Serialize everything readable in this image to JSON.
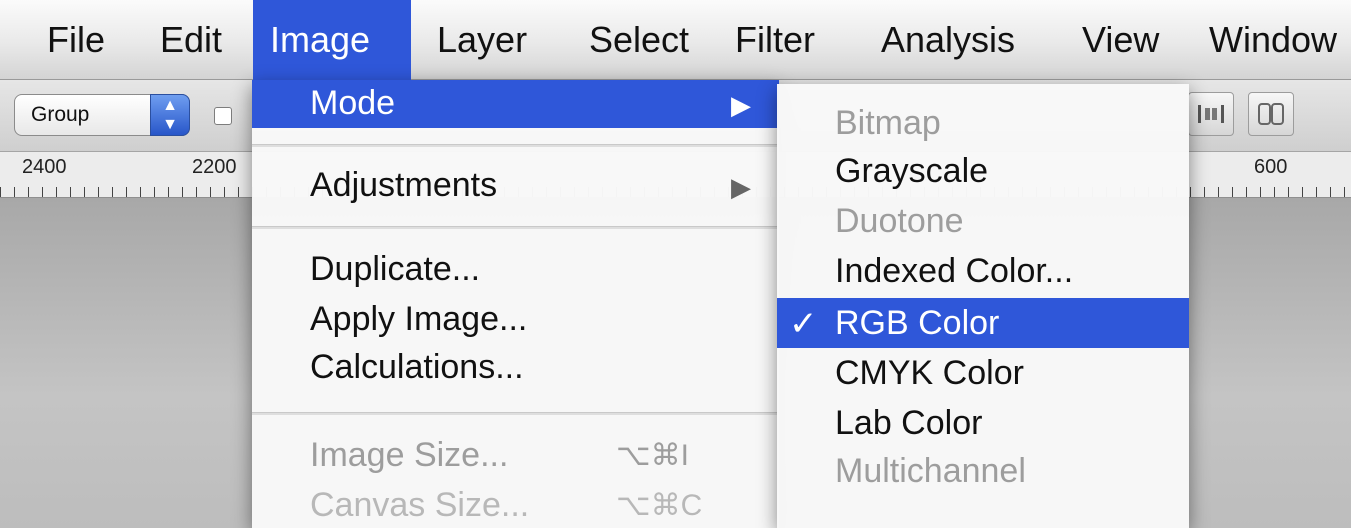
{
  "menubar": {
    "items": [
      "File",
      "Edit",
      "Image",
      "Layer",
      "Select",
      "Filter",
      "Analysis",
      "View",
      "Window"
    ],
    "active": "Image"
  },
  "options_bar": {
    "auto_select_value": "Group",
    "stepper_icon": "up-down-arrows-icon",
    "right_icons": [
      "distribute-horizontal-centers-icon",
      "auto-align-layers-icon"
    ]
  },
  "ruler": {
    "labels": [
      "2400",
      "2200",
      "600"
    ]
  },
  "image_menu": {
    "mode": "Mode",
    "adjustments": "Adjustments",
    "duplicate": "Duplicate...",
    "apply_image": "Apply Image...",
    "calculations": "Calculations...",
    "image_size": "Image Size...",
    "image_size_shortcut": "⌥⌘I",
    "canvas_size": "Canvas Size...",
    "canvas_size_shortcut": "⌥⌘C",
    "submenu_arrow": "▶"
  },
  "mode_menu": {
    "items": [
      {
        "label": "Bitmap",
        "enabled": false,
        "checked": false
      },
      {
        "label": "Grayscale",
        "enabled": true,
        "checked": false
      },
      {
        "label": "Duotone",
        "enabled": false,
        "checked": false
      },
      {
        "label": "Indexed Color...",
        "enabled": true,
        "checked": false
      },
      {
        "label": "RGB Color",
        "enabled": true,
        "checked": true
      },
      {
        "label": "CMYK Color",
        "enabled": true,
        "checked": false
      },
      {
        "label": "Lab Color",
        "enabled": true,
        "checked": false
      },
      {
        "label": "Multichannel",
        "enabled": false,
        "checked": false
      }
    ],
    "check_mark": "✓"
  },
  "colors": {
    "highlight": "#2f57d9",
    "disabled_text": "#9d9d9d"
  }
}
